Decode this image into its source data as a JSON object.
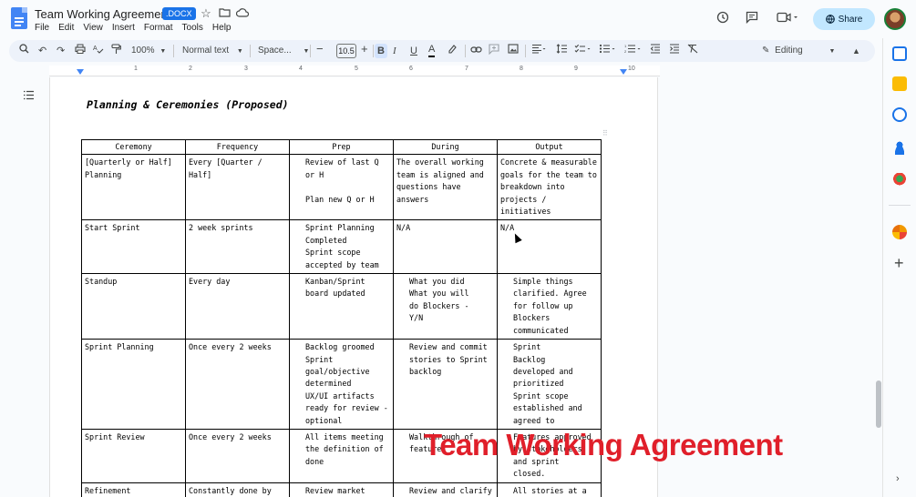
{
  "app": {
    "doc_title": "Team Working Agreement",
    "file_badge": ".DOCX",
    "menu": [
      "File",
      "Edit",
      "View",
      "Insert",
      "Format",
      "Tools",
      "Help"
    ],
    "share_label": "Share"
  },
  "toolbar": {
    "zoom": "100%",
    "style": "Normal text",
    "font": "Space...",
    "font_size": "10.5",
    "mode": "Editing"
  },
  "ruler": {
    "numbers": [
      "1",
      "2",
      "3",
      "4",
      "5",
      "6",
      "7",
      "8",
      "9",
      "10"
    ]
  },
  "document": {
    "heading": "Planning & Ceremonies (Proposed)",
    "table": {
      "headers": [
        "Ceremony",
        "Frequency",
        "Prep",
        "During",
        "Output"
      ],
      "rows": [
        [
          "[Quarterly or Half]\nPlanning",
          "Every [Quarter /\nHalf]",
          "Review of last Q\nor H\n\nPlan new Q or H",
          "The overall working\nteam is aligned and\nquestions have\nanswers",
          "Concrete & measurable\ngoals for the team to\nbreakdown into\nprojects /\ninitiatives"
        ],
        [
          "Start Sprint",
          "2 week sprints",
          "Sprint Planning\nCompleted\nSprint scope\naccepted by team",
          "N/A",
          "N/A"
        ],
        [
          "Standup",
          "Every day",
          "Kanban/Sprint\nboard updated",
          "What you did\nWhat you will\ndo Blockers -\nY/N",
          "Simple things\nclarified. Agree\nfor follow up\nBlockers\ncommunicated"
        ],
        [
          "Sprint Planning",
          "Once every 2 weeks",
          "Backlog groomed\nSprint\ngoal/objective\ndetermined\nUX/UI artifacts\nready for review -\noptional",
          "Review and commit\nstories to Sprint\nbacklog",
          "Sprint\nBacklog\ndeveloped and\nprioritized\nSprint scope\nestablished and\nagreed to"
        ],
        [
          "Sprint Review",
          "Once every 2 weeks",
          "All items meeting\nthe definition of\ndone",
          "Walkthrough of\nfeatures",
          "Features approved\nby stakeholders\nand sprint\nclosed."
        ],
        [
          "Refinement",
          "Constantly done by\nMobile Product",
          "Review market\nneeds / customer",
          "Review and clarify",
          "All stories at a\nstate ready for"
        ]
      ]
    }
  },
  "overlay": {
    "caption": "Team Working Agreement",
    "color": "#e01f2a"
  },
  "colors": {
    "accent": "#1a73e8",
    "share_bg": "#c2e7ff",
    "toolbar_bg": "#edf2fa"
  }
}
